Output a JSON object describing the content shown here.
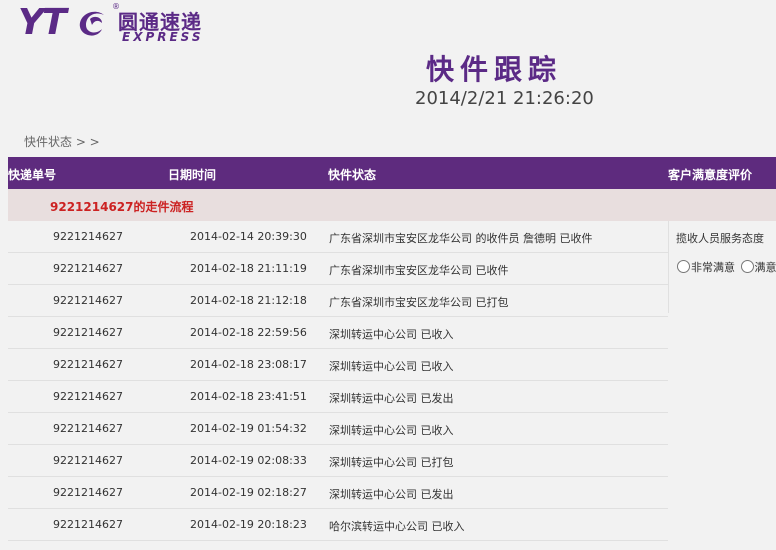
{
  "logo": {
    "mark": "YT",
    "registered": "®",
    "cn": "圆通速递",
    "en": "EXPRESS"
  },
  "title": "快件跟踪",
  "datetime": "2014/2/21 21:26:20",
  "breadcrumb": "快件状态 > >",
  "table": {
    "headers": [
      "快递单号",
      "日期时间",
      "快件状态",
      "客户满意度评价"
    ],
    "flow_title": "9221214627的走件流程",
    "rows": [
      {
        "no": "9221214627",
        "time": "2014-02-14 20:39:30",
        "status": "广东省深圳市宝安区龙华公司 的收件员 詹德明 已收件"
      },
      {
        "no": "9221214627",
        "time": "2014-02-18 21:11:19",
        "status": "广东省深圳市宝安区龙华公司 已收件"
      },
      {
        "no": "9221214627",
        "time": "2014-02-18 21:12:18",
        "status": "广东省深圳市宝安区龙华公司 已打包"
      },
      {
        "no": "9221214627",
        "time": "2014-02-18 22:59:56",
        "status": "深圳转运中心公司 已收入"
      },
      {
        "no": "9221214627",
        "time": "2014-02-18 23:08:17",
        "status": "深圳转运中心公司 已收入"
      },
      {
        "no": "9221214627",
        "time": "2014-02-18 23:41:51",
        "status": "深圳转运中心公司 已发出"
      },
      {
        "no": "9221214627",
        "time": "2014-02-19 01:54:32",
        "status": "深圳转运中心公司 已收入"
      },
      {
        "no": "9221214627",
        "time": "2014-02-19 02:08:33",
        "status": "深圳转运中心公司 已打包"
      },
      {
        "no": "9221214627",
        "time": "2014-02-19 02:18:27",
        "status": "深圳转运中心公司 已发出"
      },
      {
        "no": "9221214627",
        "time": "2014-02-19 20:18:23",
        "status": "哈尔滨转运中心公司 已收入"
      }
    ]
  },
  "rating": {
    "label": "揽收人员服务态度",
    "options": [
      "非常满意",
      "满意"
    ]
  },
  "colors": {
    "brand_purple": "#5e2b7e",
    "flow_title_red": "#cc2222",
    "flow_row_bg": "#e8dede",
    "page_bg": "#f2f2f2"
  }
}
